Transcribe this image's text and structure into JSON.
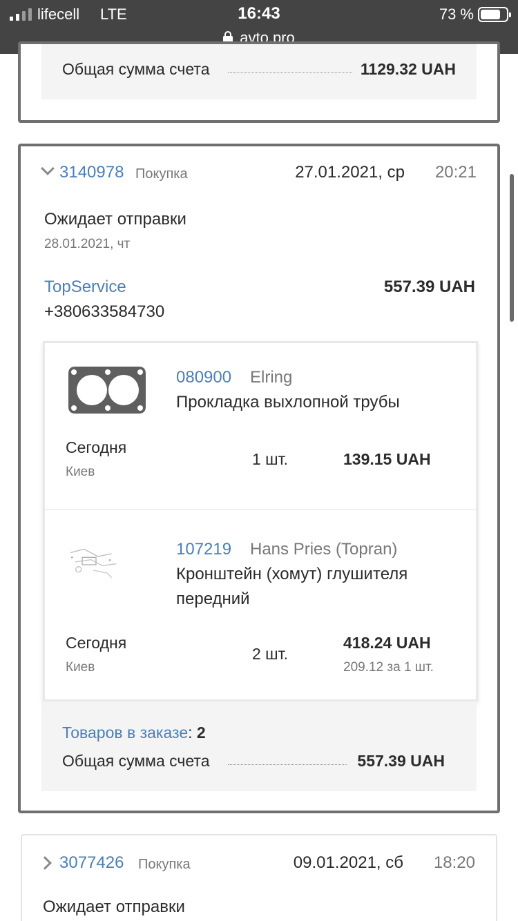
{
  "status_bar": {
    "carrier": "lifecell",
    "network": "LTE",
    "time": "16:43",
    "battery_pct": "73 %",
    "url": "avto.pro"
  },
  "prev_order": {
    "total_label": "Общая сумма счета",
    "total_value": "1129.32 UAH"
  },
  "order1": {
    "number": "3140978",
    "type": "Покупка",
    "date": "27.01.2021, ср",
    "time": "20:21",
    "status": "Ожидает отправки",
    "status_date": "28.01.2021, чт",
    "seller": "TopService",
    "phone": "+380633584730",
    "total": "557.39 UAH",
    "items": [
      {
        "code": "080900",
        "brand": "Elring",
        "name": "Прокладка выхлопной трубы",
        "delivery": "Сегодня",
        "city": "Киев",
        "qty": "1 шт.",
        "price": "139.15 UAH",
        "unit_price": ""
      },
      {
        "code": "107219",
        "brand": "Hans Pries (Topran)",
        "name": "Кронштейн (хомут) глушителя передний",
        "delivery": "Сегодня",
        "city": "Киев",
        "qty": "2 шт.",
        "price": "418.24 UAH",
        "unit_price": "209.12 за 1 шт."
      }
    ],
    "count_label": "Товаров в заказе",
    "count_value": "2",
    "sum_label": "Общая сумма счета",
    "sum_value": "557.39 UAH"
  },
  "order2": {
    "number": "3077426",
    "type": "Покупка",
    "date": "09.01.2021, сб",
    "time": "18:20",
    "status": "Ожидает отправки"
  },
  "colors": {
    "link": "#4a7fb8",
    "status_bar": "#444444",
    "muted": "#777777"
  }
}
